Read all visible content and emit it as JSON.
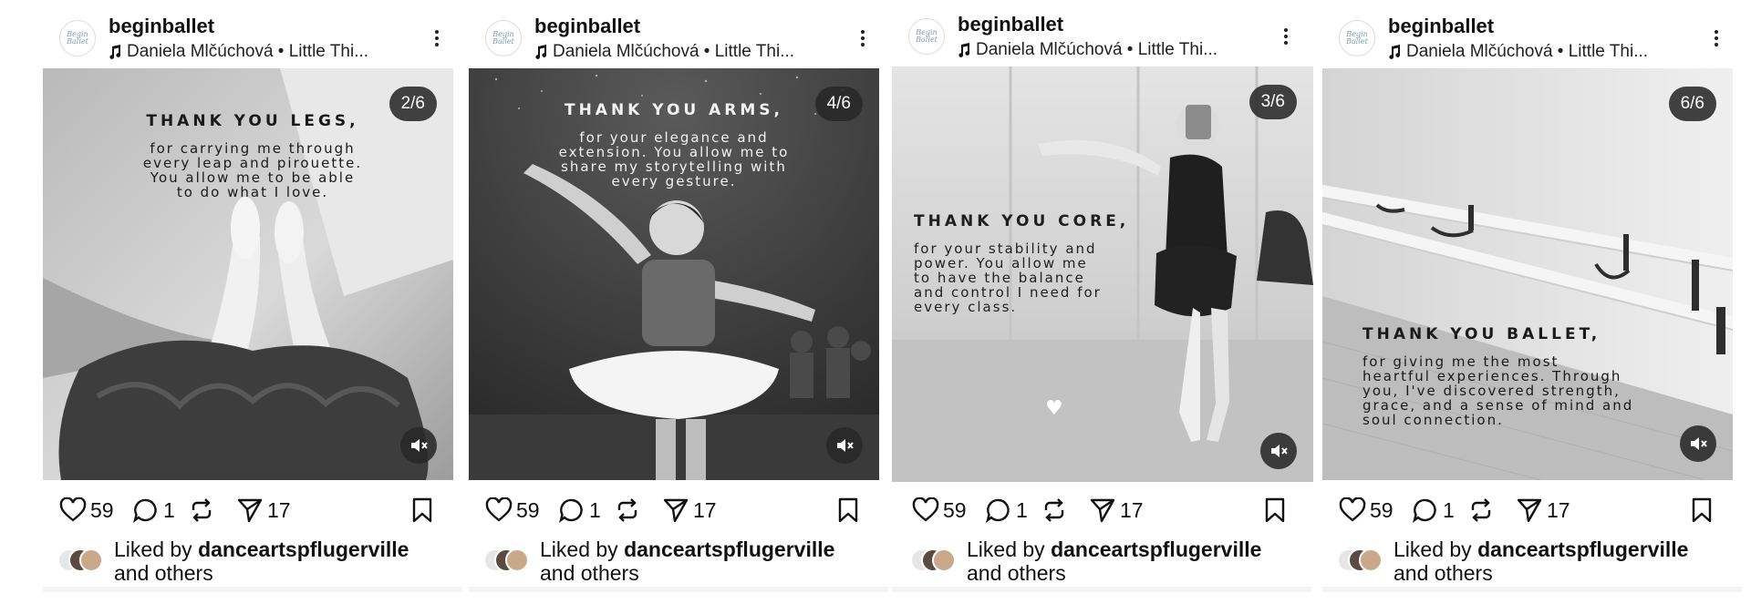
{
  "posts": [
    {
      "username": "beginballet",
      "audio": "Daniela Mlčúchová • Little Thi...",
      "avatar_text": "Begin Ballet",
      "counter": "2/6",
      "caption_title": "THANK YOU LEGS,",
      "caption_body": [
        "for carrying me through",
        "every leap and pirouette.",
        "You allow me to be able",
        "to do what I love."
      ],
      "likes": "59",
      "comments": "1",
      "shares": "17",
      "liked_prefix": "Liked by",
      "liked_user": "danceartspflugerville",
      "liked_suffix": "and others"
    },
    {
      "username": "beginballet",
      "audio": "Daniela Mlčúchová • Little Thi...",
      "avatar_text": "Begin Ballet",
      "counter": "4/6",
      "caption_title": "THANK YOU ARMS,",
      "caption_body": [
        "for your elegance and",
        "extension. You allow me to",
        "share my storytelling with",
        "every gesture."
      ],
      "likes": "59",
      "comments": "1",
      "shares": "17",
      "liked_prefix": "Liked by",
      "liked_user": "danceartspflugerville",
      "liked_suffix": "and others"
    },
    {
      "username": "beginballet",
      "audio": "Daniela Mlčúchová • Little Thi...",
      "avatar_text": "Begin Ballet",
      "counter": "3/6",
      "caption_title": "THANK YOU CORE,",
      "caption_body": [
        "for your stability and",
        "power. You allow me",
        "to have the balance",
        "and control I need for",
        "every class."
      ],
      "likes": "59",
      "comments": "1",
      "shares": "17",
      "liked_prefix": "Liked by",
      "liked_user": "danceartspflugerville",
      "liked_suffix": "and others"
    },
    {
      "username": "beginballet",
      "audio": "Daniela Mlčúchová • Little Thi...",
      "avatar_text": "Begin Ballet",
      "counter": "6/6",
      "caption_title": "THANK YOU BALLET,",
      "caption_body": [
        "for giving me the most",
        "heartful experiences. Through",
        "you, I've discovered strength,",
        "grace, and a sense of mind and",
        "soul connection."
      ],
      "likes": "59",
      "comments": "1",
      "shares": "17",
      "liked_prefix": "Liked by",
      "liked_user": "danceartspflugerville",
      "liked_suffix": "and others"
    }
  ],
  "icons": {
    "like": "heart-icon",
    "comment": "comment-bubble-icon",
    "repost": "repost-icon",
    "share": "send-icon",
    "save": "bookmark-icon",
    "mute": "speaker-muted-icon",
    "more": "more-vertical-icon",
    "music": "music-note-icon"
  }
}
